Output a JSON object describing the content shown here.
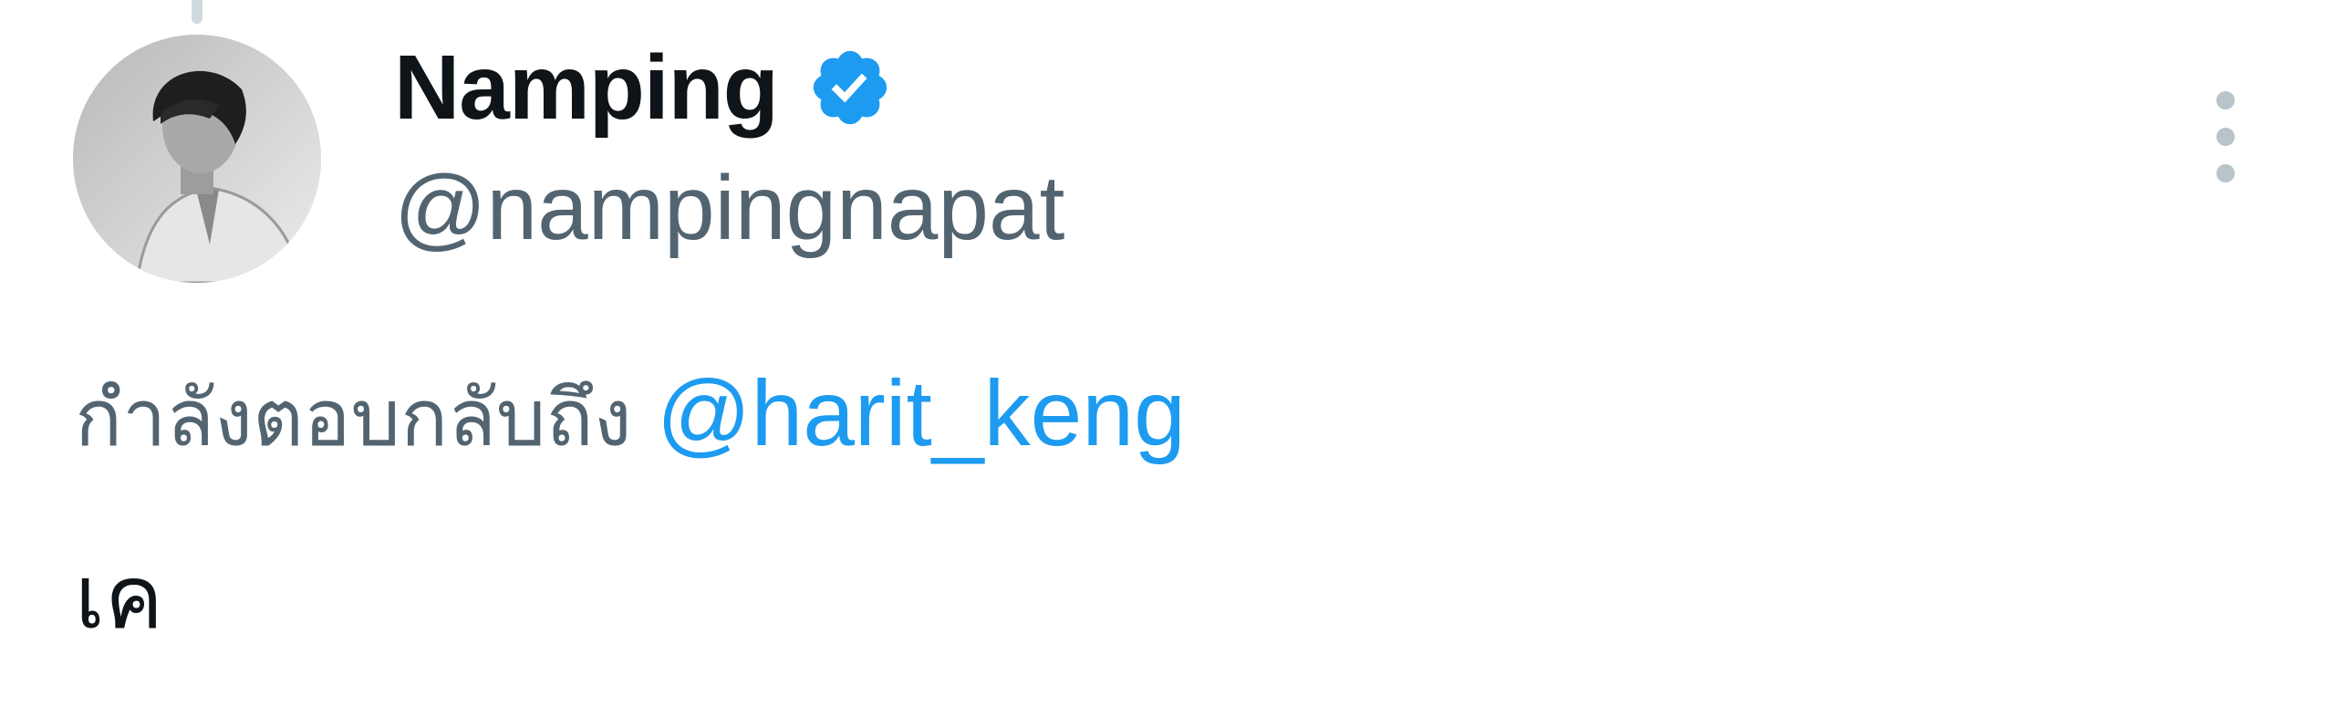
{
  "tweet": {
    "author": {
      "display_name": "Namping",
      "handle": "@nampingnapat",
      "verified": true,
      "verified_badge_icon": "verified-badge-icon",
      "avatar_icon": "profile-photo"
    },
    "reply_context": {
      "prefix": "กำลังตอบกลับถึง",
      "mention": "@harit_keng"
    },
    "text": "เค",
    "more_icon": "more-vertical-icon"
  },
  "colors": {
    "name_text": "#0f1419",
    "secondary_text": "#536471",
    "link": "#1d9bf0",
    "verified_blue": "#1d9bf0",
    "thread_line": "#cfd9de"
  }
}
